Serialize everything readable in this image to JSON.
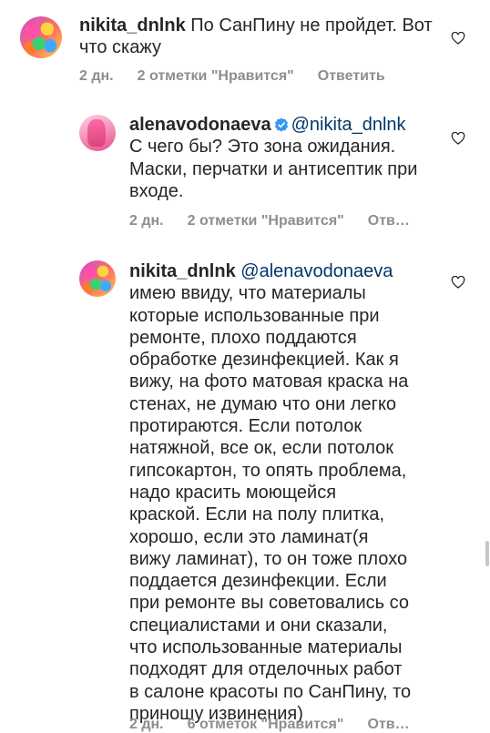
{
  "comments": [
    {
      "username": "nikita_dnlnk",
      "text": "По СанПину не пройдет. Вот\nчто скажу",
      "time": "2 дн.",
      "likes": "2 отметки \"Нравится\"",
      "reply": "Ответить"
    },
    {
      "username": "alenavodonaeva",
      "mention": "@nikita_dnlnk",
      "text": "С чего бы? Это зона ожидания.\nМаски, перчатки и антисептик при\nвходе.",
      "time": "2 дн.",
      "likes": "2 отметки \"Нравится\"",
      "reply": "Отв…"
    },
    {
      "username": "nikita_dnlnk",
      "mention": "@alenavodonaeva",
      "text": "имею ввиду, что материалы\nкоторые использованные при\nремонте, плохо поддаются\nобработке дезинфекцией. Как я\nвижу, на фото матовая краска на\nстенах, не думаю что они легко\nпротираются. Если потолок\nнатяжной, все ок, если потолок\nгипсокартон, то опять проблема,\nнадо красить моющейся\nкраской. Если на полу плитка,\nхорошо, если это ламинат(я\nвижу ламинат), то он тоже плохо\nподдается дезинфекции. Если\nпри ремонте вы советовались со\nспециалистами и они сказали,\nчто использованные материалы\nподходят для отделочных работ\nв салоне красоты по СанПину, то\nприношу извинения)",
      "time": "2 дн.",
      "likes": "6 отметок \"Нравится\"",
      "reply": "Отв…"
    }
  ],
  "colors": {
    "text": "#262626",
    "meta": "#8e8e8e",
    "mention": "#00376b",
    "verified": "#3897f0"
  },
  "icons": [
    "heart-outline-icon",
    "verified-badge-icon"
  ]
}
